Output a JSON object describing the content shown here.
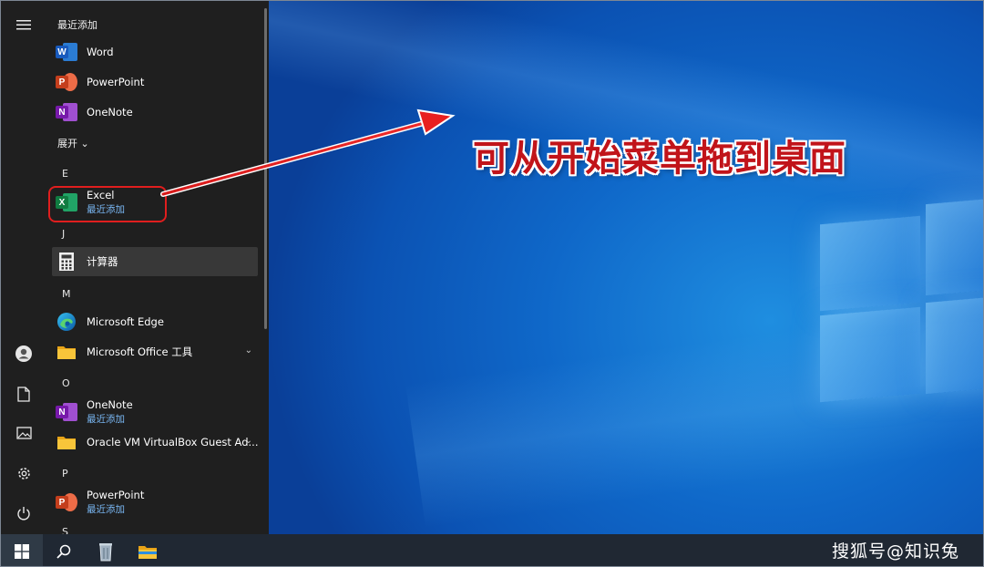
{
  "start_menu": {
    "recent_section_title": "最近添加",
    "expand_label": "展开",
    "recent_apps": [
      {
        "name": "Word"
      },
      {
        "name": "PowerPoint"
      },
      {
        "name": "OneNote"
      }
    ],
    "letters": [
      "E",
      "J",
      "M",
      "O",
      "P",
      "S"
    ],
    "apps": {
      "excel": {
        "name": "Excel",
        "sub": "最近添加"
      },
      "calculator": {
        "name": "计算器"
      },
      "edge": {
        "name": "Microsoft Edge"
      },
      "office_tools": {
        "name": "Microsoft Office 工具"
      },
      "onenote": {
        "name": "OneNote",
        "sub": "最近添加"
      },
      "virtualbox": {
        "name": "Oracle VM VirtualBox Guest Ad..."
      },
      "powerpoint": {
        "name": "PowerPoint",
        "sub": "最近添加"
      }
    }
  },
  "annotation": {
    "headline": "可从开始菜单拖到桌面",
    "color": "#c1141a"
  },
  "watermark": "搜狐号@知识兔",
  "colors": {
    "menu_bg": "#1f1f1f",
    "accent_text": "#7ab8f5",
    "highlight_ring": "#e01e1e",
    "taskbar_bg": "#202833"
  },
  "icons": [
    "hamburger-icon",
    "user-icon",
    "document-icon",
    "pictures-icon",
    "settings-icon",
    "power-icon",
    "windows-icon",
    "search-icon",
    "recycle-icon",
    "file-explorer-icon"
  ]
}
